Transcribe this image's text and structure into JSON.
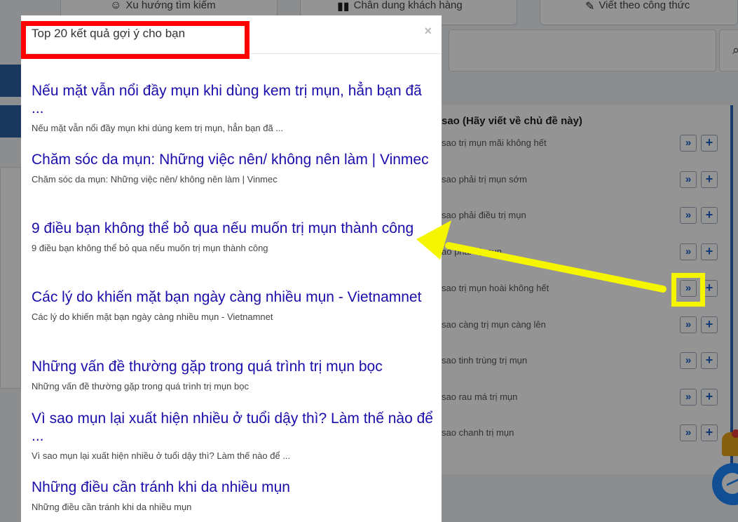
{
  "nav": {
    "item1": "Xu hướng tìm kiếm",
    "item2": "Chân dung khách hàng",
    "item3": "Viết theo công thức"
  },
  "suggest_panel": {
    "title": "sao (Hãy viết về chủ đề này)",
    "go_symbol": "»",
    "add_symbol": "+",
    "keywords": [
      "sao trị mụn mãi không hết",
      "sao phải trị mụn sớm",
      "sao phải điều trị mụn",
      "ao phải trị mụn",
      "sao trị mụn hoài không hết",
      "sao càng trị mụn càng lên",
      "sao tinh trùng trị mụn",
      "sao rau má trị mụn",
      "sao chanh trị mụn"
    ]
  },
  "modal": {
    "title": "Top 20 kết quả gợi ý cho bạn",
    "close": "×",
    "results": [
      {
        "title": "Nếu mặt vẫn nổi đầy mụn khi dùng kem trị mụn, hẳn bạn đã ...",
        "snippet": "Nếu mặt vẫn nổi đầy mụn khi dùng kem trị mụn, hẳn bạn đã ..."
      },
      {
        "title": "Chăm sóc da mụn: Những việc nên/ không nên làm | Vinmec",
        "snippet": "Chăm sóc da mụn: Những việc nên/ không nên làm | Vinmec"
      },
      {
        "title": "9 điều bạn không thể bỏ qua nếu muốn trị mụn thành công",
        "snippet": "9 điều bạn không thể bỏ qua nếu muốn trị mụn thành công"
      },
      {
        "title": "Các lý do khiến mặt bạn ngày càng nhiều mụn - Vietnamnet",
        "snippet": "Các lý do khiến mặt bạn ngày càng nhiều mụn - Vietnamnet"
      },
      {
        "title": "Những vấn đề thường gặp trong quá trình trị mụn bọc",
        "snippet": "Những vấn đề thường gặp trong quá trình trị mụn bọc"
      },
      {
        "title": "Vì sao mụn lại xuất hiện nhiều ở tuổi dậy thì? Làm thế nào để ...",
        "snippet": "Vì sao mụn lại xuất hiện nhiều ở tuổi dậy thì? Làm thế nào để ..."
      },
      {
        "title": "Những điều cần tránh khi da nhiều mụn",
        "snippet": "Những điều cần tránh khi da nhiều mụn"
      }
    ]
  },
  "colors": {
    "link": "#1a0dab",
    "annotation_red": "#ff0000",
    "annotation_yellow": "#f5f500",
    "accent_blue": "#2a66b8"
  }
}
